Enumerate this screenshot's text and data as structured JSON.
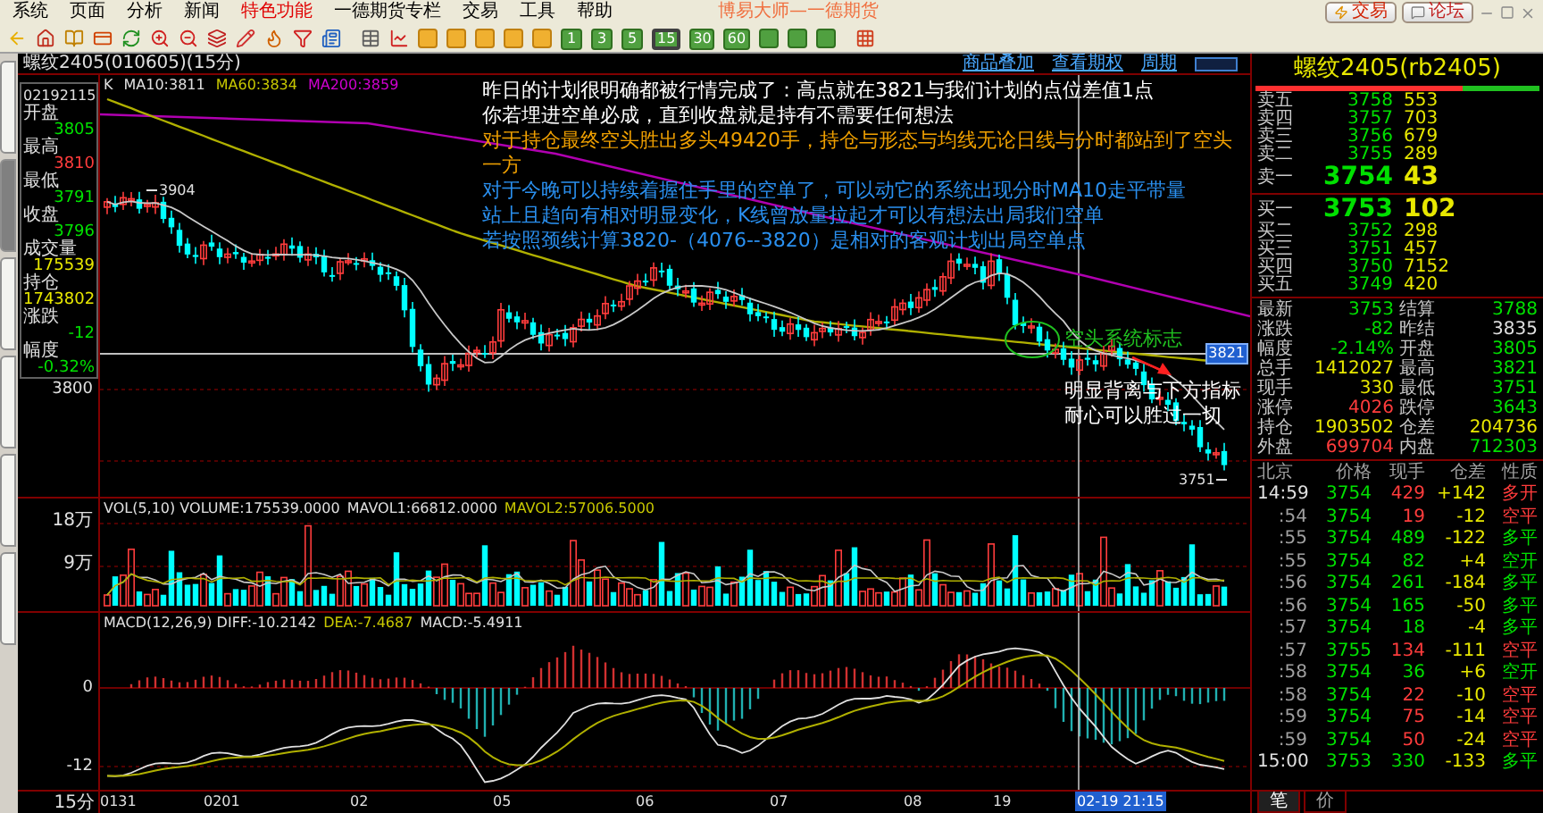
{
  "menu": [
    {
      "label": "系统",
      "selected": false
    },
    {
      "label": "页面",
      "selected": false
    },
    {
      "label": "分析",
      "selected": false
    },
    {
      "label": "新闻",
      "selected": false
    },
    {
      "label": "特色功能",
      "selected": true
    },
    {
      "label": "一德期货专栏",
      "selected": false
    },
    {
      "label": "交易",
      "selected": false
    },
    {
      "label": "工具",
      "selected": false
    },
    {
      "label": "帮助",
      "selected": false
    }
  ],
  "app_title": "博易大师—一德期货",
  "top_buttons": [
    "交易",
    "论坛"
  ],
  "periods": [
    {
      "label": "1",
      "selected": false
    },
    {
      "label": "3",
      "selected": false
    },
    {
      "label": "5",
      "selected": false
    },
    {
      "label": "15",
      "selected": true
    },
    {
      "label": "30",
      "selected": false
    },
    {
      "label": "60",
      "selected": false
    }
  ],
  "chart_header": {
    "title": "螺纹2405(010605)(15分)",
    "links": [
      "商品叠加",
      "查看期权",
      "周期"
    ]
  },
  "side_tabs": [
    {
      "selected": false
    },
    {
      "selected": true
    },
    {
      "selected": false
    },
    {
      "selected": false
    },
    {
      "selected": false
    },
    {
      "selected": false
    }
  ],
  "info_box": {
    "time": "02192115",
    "fields": [
      {
        "label": "开盘",
        "value": "3805",
        "color": "#00e000"
      },
      {
        "label": "最高",
        "value": "3810",
        "color": "#ff3c3c"
      },
      {
        "label": "最低",
        "value": "3791",
        "color": "#00e000"
      },
      {
        "label": "收盘",
        "value": "3796",
        "color": "#00e000"
      },
      {
        "label": "成交量",
        "value": "175539",
        "color": "#e8e800"
      },
      {
        "label": "持仓",
        "value": "1743802",
        "color": "#e8e800"
      },
      {
        "label": "涨跌",
        "value": "-12",
        "color": "#00e000"
      },
      {
        "label": "幅度",
        "value": "-0.32%",
        "color": "#00e000"
      }
    ]
  },
  "price_chart": {
    "legend": [
      {
        "text": "K",
        "color": "#e0e0e0"
      },
      {
        "text": "MA10:3811",
        "color": "#e0e0e0"
      },
      {
        "text": "MA60:3834",
        "color": "#c8c800"
      },
      {
        "text": "MA200:3859",
        "color": "#d000d0"
      }
    ],
    "price_label": "3800",
    "high_mark": "3904",
    "low_mark": "3751",
    "line_tag": "3821"
  },
  "annotations": [
    {
      "text": "昨日的计划很明确都被行情完成了：高点就在3821与我们计划的点位差值1点",
      "color": "#ffffff"
    },
    {
      "text": "你若埋进空单必成，直到收盘就是持有不需要任何想法",
      "color": "#ffffff"
    },
    {
      "text": "对于持仓最终空头胜出多头49420手，持仓与形态与均线无论日线与分时都站到了空头一方",
      "color": "#f0a000"
    },
    {
      "text": "对于今晚可以持续着握住手里的空单了，可以动它的系统出现分时MA10走平带量",
      "color": "#2a90f0"
    },
    {
      "text": "站上且趋向有相对明显变化，K线曾放量拉起才可以有想法出局我们空单",
      "color": "#2a90f0"
    },
    {
      "text": "若按照颈线计算3820-（4076--3820）是相对的客观计划出局空单点",
      "color": "#2a90f0"
    }
  ],
  "signal_note": "空头系统标志",
  "arrow_note": "明显背离与下方指标耐心可以胜过一切",
  "volume": {
    "legend": [
      {
        "text": "VOL(5,10) VOLUME:175539.0000",
        "color": "#e0e0e0"
      },
      {
        "text": "MAVOL1:66812.0000",
        "color": "#e0e0e0"
      },
      {
        "text": "MAVOL2:57006.5000",
        "color": "#c8c800"
      }
    ],
    "ticks": [
      "18万",
      "9万"
    ]
  },
  "macd": {
    "legend": [
      {
        "text": "MACD(12,26,9) DIFF:-10.2142",
        "color": "#e0e0e0"
      },
      {
        "text": "DEA:-7.4687",
        "color": "#c8c800"
      },
      {
        "text": "MACD:-5.4911",
        "color": "#e0e0e0"
      }
    ],
    "ticks": [
      "0",
      "-12"
    ]
  },
  "x_axis": {
    "unit": "15分",
    "labels": [
      "0131",
      "0201",
      "02",
      "05",
      "06",
      "07",
      "08",
      "19"
    ],
    "cursor": "02-19 21:15"
  },
  "quote": {
    "title": "螺纹2405(rb2405)",
    "strength": {
      "level": 0.73
    },
    "asks": [
      {
        "label": "卖五",
        "price": "3758",
        "volume": "553"
      },
      {
        "label": "卖四",
        "price": "3757",
        "volume": "703"
      },
      {
        "label": "卖三",
        "price": "3756",
        "volume": "679"
      },
      {
        "label": "卖二",
        "price": "3755",
        "volume": "289"
      },
      {
        "label": "卖一",
        "price": "3754",
        "volume": "43"
      }
    ],
    "bids": [
      {
        "label": "买一",
        "price": "3753",
        "volume": "102"
      },
      {
        "label": "买二",
        "price": "3752",
        "volume": "298"
      },
      {
        "label": "买三",
        "price": "3751",
        "volume": "457"
      },
      {
        "label": "买四",
        "price": "3750",
        "volume": "7152"
      },
      {
        "label": "买五",
        "price": "3749",
        "volume": "420"
      }
    ],
    "stats": [
      {
        "label": "最新",
        "value": "3753",
        "color": "#00e000"
      },
      {
        "label": "结算",
        "value": "3788",
        "color": "#00e000"
      },
      {
        "label": "涨跌",
        "value": "-82",
        "color": "#00e000"
      },
      {
        "label": "昨结",
        "value": "3835",
        "color": "#e0e0e0"
      },
      {
        "label": "幅度",
        "value": "-2.14%",
        "color": "#00e000"
      },
      {
        "label": "开盘",
        "value": "3805",
        "color": "#00e000"
      },
      {
        "label": "总手",
        "value": "1412027",
        "color": "#e8e800"
      },
      {
        "label": "最高",
        "value": "3821",
        "color": "#00e000"
      },
      {
        "label": "现手",
        "value": "330",
        "color": "#e8e800"
      },
      {
        "label": "最低",
        "value": "3751",
        "color": "#00e000"
      },
      {
        "label": "涨停",
        "value": "4026",
        "color": "#ff3c3c"
      },
      {
        "label": "跌停",
        "value": "3643",
        "color": "#00e000"
      },
      {
        "label": "持仓",
        "value": "1903502",
        "color": "#e8e800"
      },
      {
        "label": "仓差",
        "value": "204736",
        "color": "#e8e800"
      },
      {
        "label": "外盘",
        "value": "699704",
        "color": "#ff3c3c"
      },
      {
        "label": "内盘",
        "value": "712303",
        "color": "#00e000"
      }
    ]
  },
  "ticks": {
    "columns": [
      "北京",
      "价格",
      "现手",
      "仓差",
      "性质"
    ],
    "rows": [
      {
        "time": "14:59",
        "price": "3754",
        "volume": "429",
        "change": "+142",
        "nature": "多开",
        "color": "#ff3c3c"
      },
      {
        "time": ":54",
        "price": "3754",
        "volume": "19",
        "change": "-12",
        "nature": "空平",
        "color": "#ff3c3c"
      },
      {
        "time": ":55",
        "price": "3754",
        "volume": "489",
        "change": "-122",
        "nature": "多平",
        "color": "#00e000"
      },
      {
        "time": ":55",
        "price": "3754",
        "volume": "82",
        "change": "+4",
        "nature": "空开",
        "color": "#00e000"
      },
      {
        "time": ":56",
        "price": "3754",
        "volume": "261",
        "change": "-184",
        "nature": "多平",
        "color": "#00e000"
      },
      {
        "time": ":56",
        "price": "3754",
        "volume": "165",
        "change": "-50",
        "nature": "多平",
        "color": "#00e000"
      },
      {
        "time": ":57",
        "price": "3754",
        "volume": "18",
        "change": "-4",
        "nature": "多平",
        "color": "#00e000"
      },
      {
        "time": ":57",
        "price": "3755",
        "volume": "134",
        "change": "-111",
        "nature": "空平",
        "color": "#ff3c3c"
      },
      {
        "time": ":58",
        "price": "3754",
        "volume": "36",
        "change": "+6",
        "nature": "空开",
        "color": "#00e000"
      },
      {
        "time": ":58",
        "price": "3754",
        "volume": "22",
        "change": "-10",
        "nature": "空平",
        "color": "#ff3c3c"
      },
      {
        "time": ":59",
        "price": "3754",
        "volume": "75",
        "change": "-14",
        "nature": "空平",
        "color": "#ff3c3c"
      },
      {
        "time": ":59",
        "price": "3754",
        "volume": "50",
        "change": "-24",
        "nature": "空平",
        "color": "#ff3c3c"
      },
      {
        "time": "15:00",
        "price": "3753",
        "volume": "330",
        "change": "-133",
        "nature": "多平",
        "color": "#00e000"
      }
    ]
  },
  "bottom_tabs": [
    {
      "label": "笔",
      "selected": true
    },
    {
      "label": "价",
      "selected": false
    }
  ]
}
